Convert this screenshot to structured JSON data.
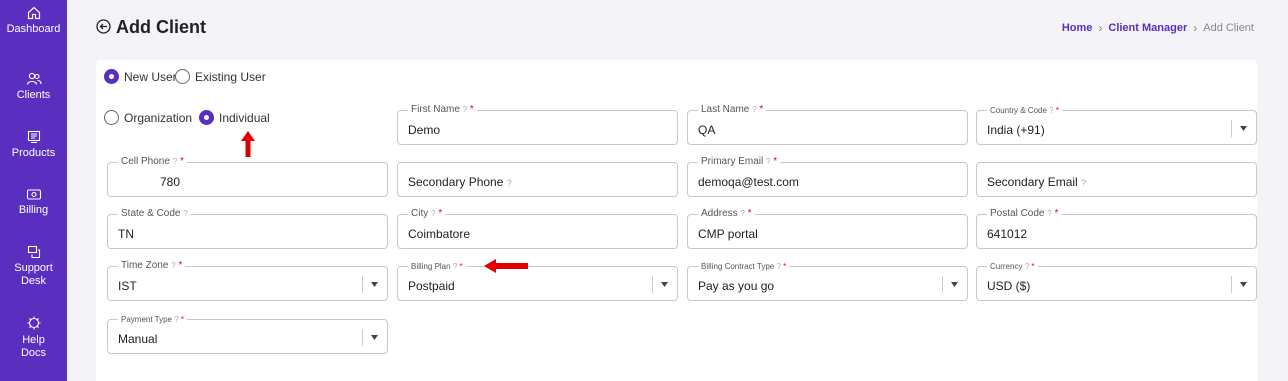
{
  "sidebar": {
    "items": [
      {
        "label": "Dashboard",
        "icon": "home-icon"
      },
      {
        "label": "Clients",
        "icon": "clients-icon"
      },
      {
        "label": "Products",
        "icon": "products-icon"
      },
      {
        "label": "Billing",
        "icon": "billing-icon"
      },
      {
        "label": "Support Desk",
        "icon": "support-icon"
      },
      {
        "label": "Help Docs",
        "icon": "help-icon"
      }
    ]
  },
  "header": {
    "title": "Add Client",
    "breadcrumb": {
      "home": "Home",
      "section": "Client Manager",
      "current": "Add Client"
    }
  },
  "form": {
    "user_type": {
      "new": "New User",
      "existing": "Existing User",
      "selected": "New User"
    },
    "client_type": {
      "org": "Organization",
      "individual": "Individual",
      "selected": "Individual"
    },
    "help_symbol": "?",
    "required_symbol": "*",
    "fields": {
      "first_name": {
        "label": "First Name",
        "value": "Demo"
      },
      "last_name": {
        "label": "Last Name",
        "value": "QA"
      },
      "country_code": {
        "label": "Country & Code",
        "value": "India (+91)"
      },
      "cell_phone": {
        "label": "Cell Phone",
        "value": "780"
      },
      "secondary_phone": {
        "label": "Secondary Phone"
      },
      "primary_email": {
        "label": "Primary Email",
        "value": "demoqa@test.com"
      },
      "secondary_email": {
        "label": "Secondary Email"
      },
      "state_code": {
        "label": "State & Code",
        "value": "TN"
      },
      "city": {
        "label": "City",
        "value": "Coimbatore"
      },
      "address": {
        "label": "Address",
        "value": "CMP portal"
      },
      "postal_code": {
        "label": "Postal Code",
        "value": "641012"
      },
      "time_zone": {
        "label": "Time Zone",
        "value": "IST"
      },
      "billing_plan": {
        "label": "Billing Plan",
        "value": "Postpaid"
      },
      "billing_contract_type": {
        "label": "Billing Contract Type",
        "value": "Pay as you go"
      },
      "currency": {
        "label": "Currency",
        "value": "USD ($)"
      },
      "payment_type": {
        "label": "Payment Type",
        "value": "Manual"
      }
    }
  },
  "colors": {
    "brand": "#5a2fbf",
    "annotation_arrow": "#e00000"
  }
}
